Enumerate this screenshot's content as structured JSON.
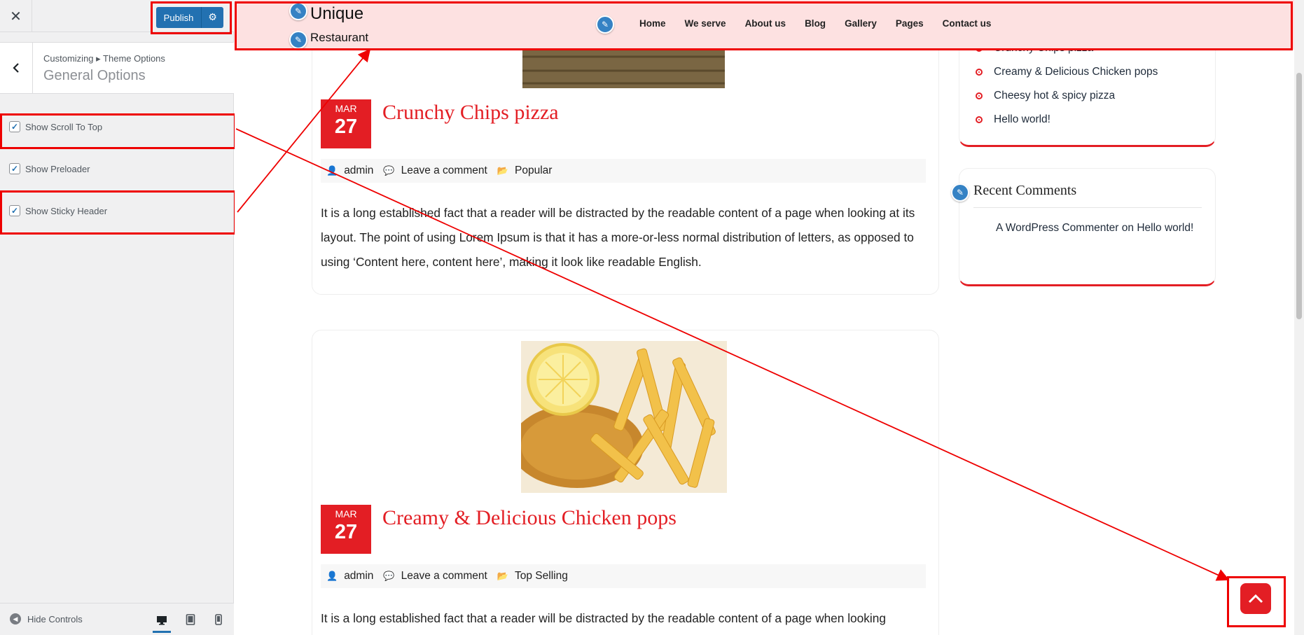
{
  "customizer": {
    "close_glyph": "✕",
    "publish_label": "Publish",
    "gear_glyph": "⚙",
    "back_glyph": "‹",
    "breadcrumb": "Customizing ▸ Theme Options",
    "section_title": "General Options",
    "options": [
      {
        "label": "Show Scroll To Top",
        "checked": true
      },
      {
        "label": "Show Preloader",
        "checked": true
      },
      {
        "label": "Show Sticky Header",
        "checked": true
      }
    ],
    "hide_controls_label": "Hide Controls",
    "devices": [
      "desktop",
      "tablet",
      "mobile"
    ],
    "accent_color": "#2271b1"
  },
  "site": {
    "title": "Unique",
    "tagline": "Restaurant",
    "nav": [
      "Home",
      "We serve",
      "About us",
      "Blog",
      "Gallery",
      "Pages",
      "Contact us"
    ],
    "accent_color": "#e31e24",
    "header_bg": "#fde1e1"
  },
  "posts": [
    {
      "month": "MAR",
      "day": "27",
      "title": "Crunchy Chips pizza",
      "author": "admin",
      "comment_link": "Leave a comment",
      "category": "Popular",
      "excerpt": "It is a long established fact that a reader will be distracted by the readable content of a page when looking at its layout. The point of using Lorem Ipsum is that it has a more-or-less normal distribution of letters, as opposed to using ‘Content here, content here’, making it look like readable English."
    },
    {
      "month": "MAR",
      "day": "27",
      "title": "Creamy & Delicious Chicken pops",
      "author": "admin",
      "comment_link": "Leave a comment",
      "category": "Top Selling",
      "excerpt": "It is a long established fact that a reader will be distracted by the readable content of a page when looking"
    }
  ],
  "recent_posts": {
    "items": [
      "Crunchy Chips pizza",
      "Creamy & Delicious Chicken pops",
      "Cheesy hot & spicy pizza",
      "Hello world!"
    ]
  },
  "recent_comments": {
    "title": "Recent Comments",
    "author": "A WordPress Commenter",
    "on": "on",
    "post": "Hello world!"
  },
  "icons": {
    "pencil": "edit-shortcut-icon",
    "user": "user-icon",
    "comment": "comment-icon",
    "folder": "folder-icon",
    "scroll_top": "chevron-up-icon"
  }
}
